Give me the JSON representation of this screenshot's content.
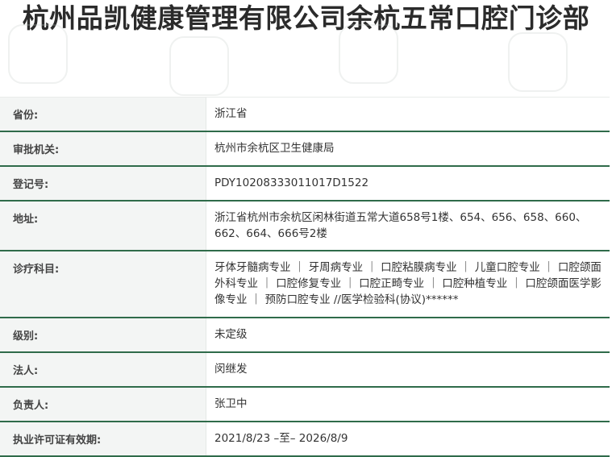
{
  "title": "杭州品凯健康管理有限公司余杭五常口腔门诊部",
  "rows": [
    {
      "label": "省份:",
      "value": "浙江省"
    },
    {
      "label": "审批机关:",
      "value": "杭州市余杭区卫生健康局"
    },
    {
      "label": "登记号:",
      "value": "PDY10208333011017D1522"
    },
    {
      "label": "地址:",
      "value": "浙江省杭州市余杭区闲林街道五常大道658号1楼、654、656、658、660、662、664、666号2楼"
    },
    {
      "label": "诊疗科目:",
      "value": "牙体牙髓病专业 ｜ 牙周病专业 ｜ 口腔粘膜病专业 ｜ 儿童口腔专业 ｜ 口腔颌面外科专业 ｜ 口腔修复专业 ｜ 口腔正畸专业 ｜ 口腔种植专业 ｜ 口腔颌面医学影像专业 ｜ 预防口腔专业 //医学检验科(协议)******"
    },
    {
      "label": "级别:",
      "value": "未定级"
    },
    {
      "label": "法人:",
      "value": "闵继发"
    },
    {
      "label": "负责人:",
      "value": "张卫中"
    },
    {
      "label": "执业许可证有效期:",
      "value": "2021/8/23 –至– 2026/8/9"
    }
  ]
}
